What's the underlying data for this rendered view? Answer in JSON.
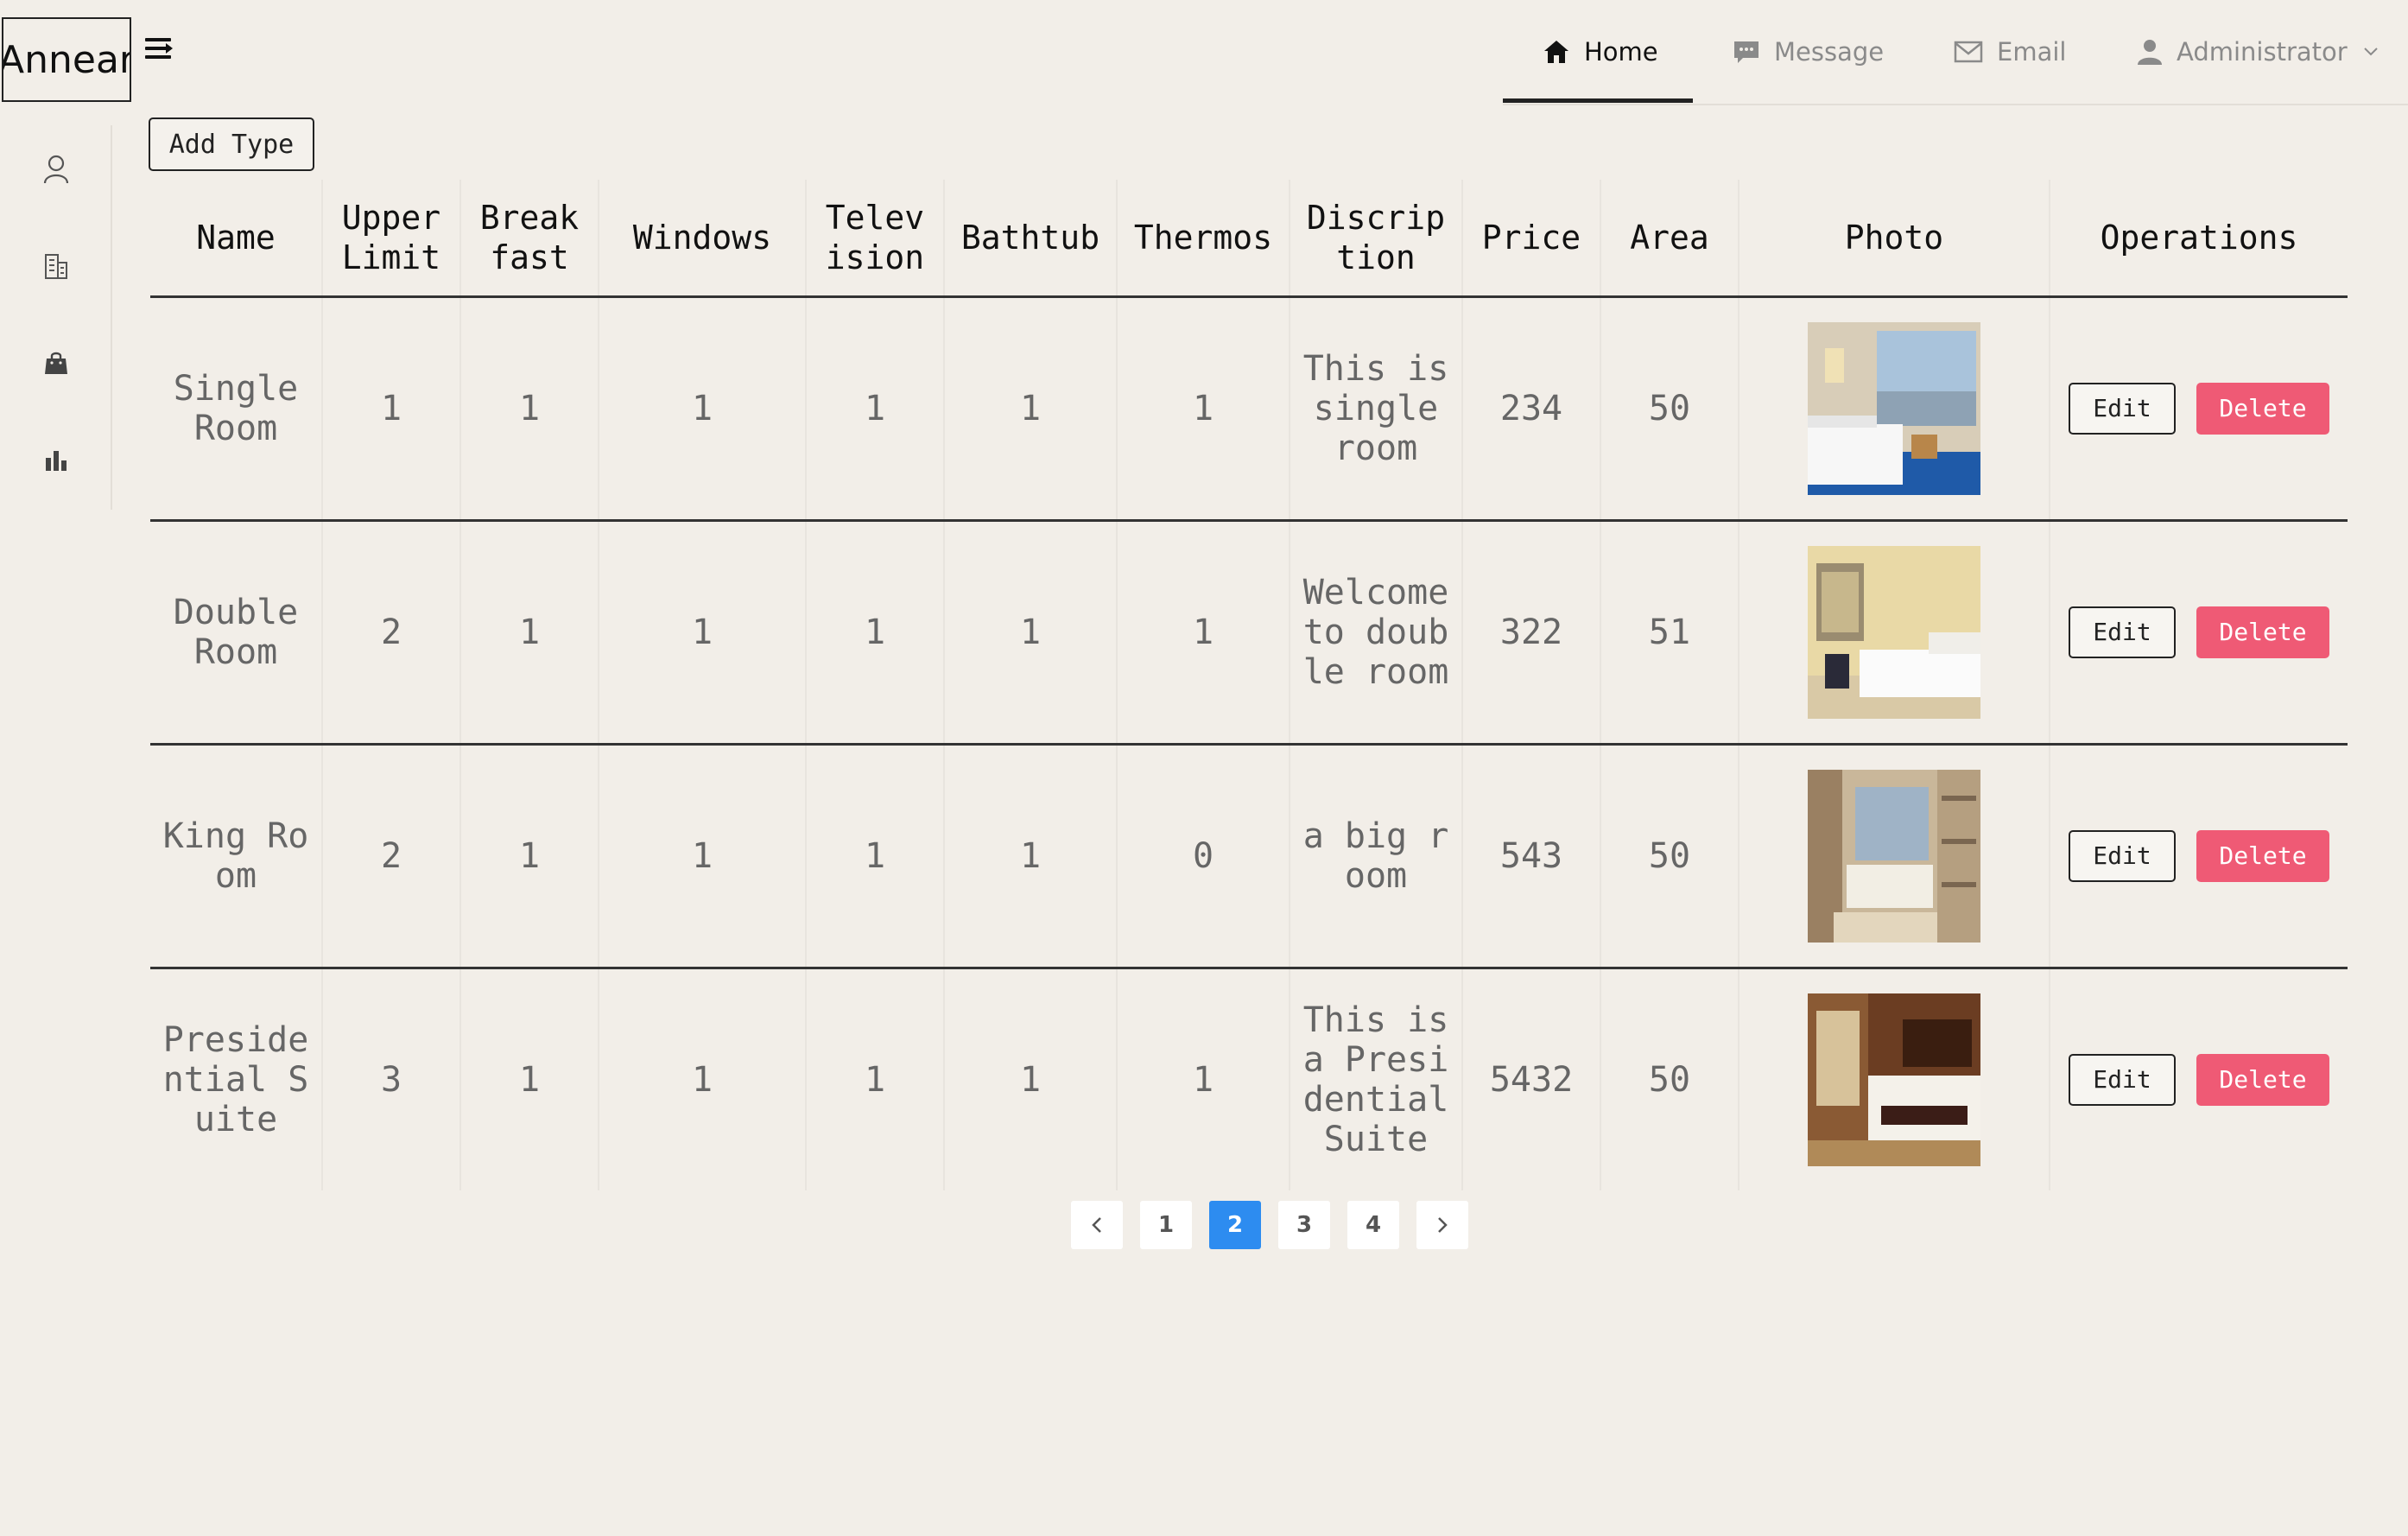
{
  "app": {
    "logo_text": "Annear"
  },
  "topnav": {
    "items": [
      {
        "label": "Home",
        "icon": "home-icon",
        "active": true
      },
      {
        "label": "Message",
        "icon": "chat-icon",
        "active": false
      },
      {
        "label": "Email",
        "icon": "envelope-icon",
        "active": false
      },
      {
        "label": "Administrator",
        "icon": "user-icon",
        "active": false
      }
    ]
  },
  "sidebar": {
    "icons": [
      "user-icon",
      "building-icon",
      "bag-icon",
      "bar-chart-icon"
    ]
  },
  "toolbar": {
    "add_label": "Add Type"
  },
  "table": {
    "headers": [
      "Name",
      "Upper Limit",
      "Break fast",
      "Windows",
      "Telev ision",
      "Bathtub",
      "Thermos",
      "Discrip tion",
      "Price",
      "Area",
      "Photo",
      "Operations"
    ],
    "rows": [
      {
        "name": "Single Room",
        "upper_limit": "1",
        "breakfast": "1",
        "windows": "1",
        "television": "1",
        "bathtub": "1",
        "thermos": "1",
        "description": "This is single room",
        "price": "234",
        "area": "50"
      },
      {
        "name": "Double Room",
        "upper_limit": "2",
        "breakfast": "1",
        "windows": "1",
        "television": "1",
        "bathtub": "1",
        "thermos": "1",
        "description": "Welcome to double room",
        "price": "322",
        "area": "51"
      },
      {
        "name": "King Room",
        "upper_limit": "2",
        "breakfast": "1",
        "windows": "1",
        "television": "1",
        "bathtub": "1",
        "thermos": "0",
        "description": "a big room",
        "price": "543",
        "area": "50"
      },
      {
        "name": "Presidential Suite",
        "upper_limit": "3",
        "breakfast": "1",
        "windows": "1",
        "television": "1",
        "bathtub": "1",
        "thermos": "1",
        "description": "This is a Presidential Suite",
        "price": "5432",
        "area": "50"
      }
    ],
    "edit_label": "Edit",
    "delete_label": "Delete"
  },
  "pagination": {
    "pages": [
      "1",
      "2",
      "3",
      "4"
    ],
    "current": "2"
  },
  "colors": {
    "background": "#f2eee8",
    "delete": "#ef5a75",
    "page_active": "#2d8cf0"
  }
}
